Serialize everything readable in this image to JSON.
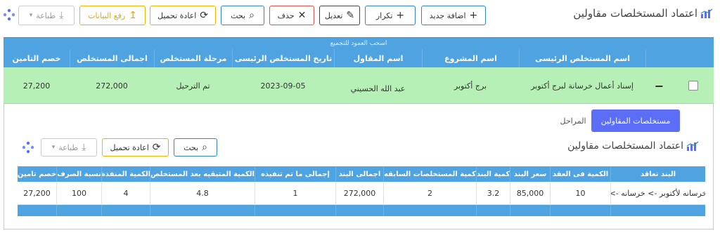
{
  "page": {
    "title": "اعتماد المستخلصات مقاولين"
  },
  "toolbar": {
    "add_new": "اضافة جديد",
    "repeat": "تكرار",
    "edit": "تعديل",
    "delete": "حذف",
    "search": "بحث",
    "reload": "اعادة تحميل",
    "upload": "رفع البيانات",
    "print": "طباعة"
  },
  "grid": {
    "group_hint": "اسحب العمود للتجميع",
    "columns": [
      "اسم المستخلص الرئيسى",
      "اسم المشروع",
      "اسم المقاول",
      "تاريخ المستخلص الرئيسى",
      "مرحلة المستخلص",
      "اجمالى المستخلص",
      "خصم التامين"
    ],
    "row": {
      "main_extract_name": "إسناد أعمال خرسانة لبرج أكتوبر",
      "project_name": "برج أكتوبر",
      "contractor_name": "عبد الله الحسيني",
      "extract_date": "2023-09-05",
      "stage": "تم الترحيل",
      "total": "272,000",
      "insurance_deduction": "27,200"
    }
  },
  "tabs": {
    "active": "مستخلصات المقاولين",
    "other": "المراحل"
  },
  "subsection": {
    "title": "اعتماد المستخلصات مقاولين",
    "search": "بحث",
    "reload": "اعادة تحميل",
    "print": "طباعة"
  },
  "subgrid": {
    "columns": [
      "البند تعاقد",
      "الكمية فى العقد",
      "سعر البند",
      "كمية البند",
      "كمية المستخلصات السابقه",
      "اجمالى البند",
      "إجمالى ما تم تنفيذه",
      "الكمية المتبقيه بعد المستخلص",
      "الكمية المنفذة",
      "نسبة الصرف",
      "خصم تامين"
    ],
    "row": [
      "خرسانه لأكتوبر -> خرسانه ->",
      "10",
      "85,000",
      "3.2",
      "2",
      "272,000",
      "1",
      "4.8",
      "4",
      "100",
      "27,200"
    ]
  }
}
